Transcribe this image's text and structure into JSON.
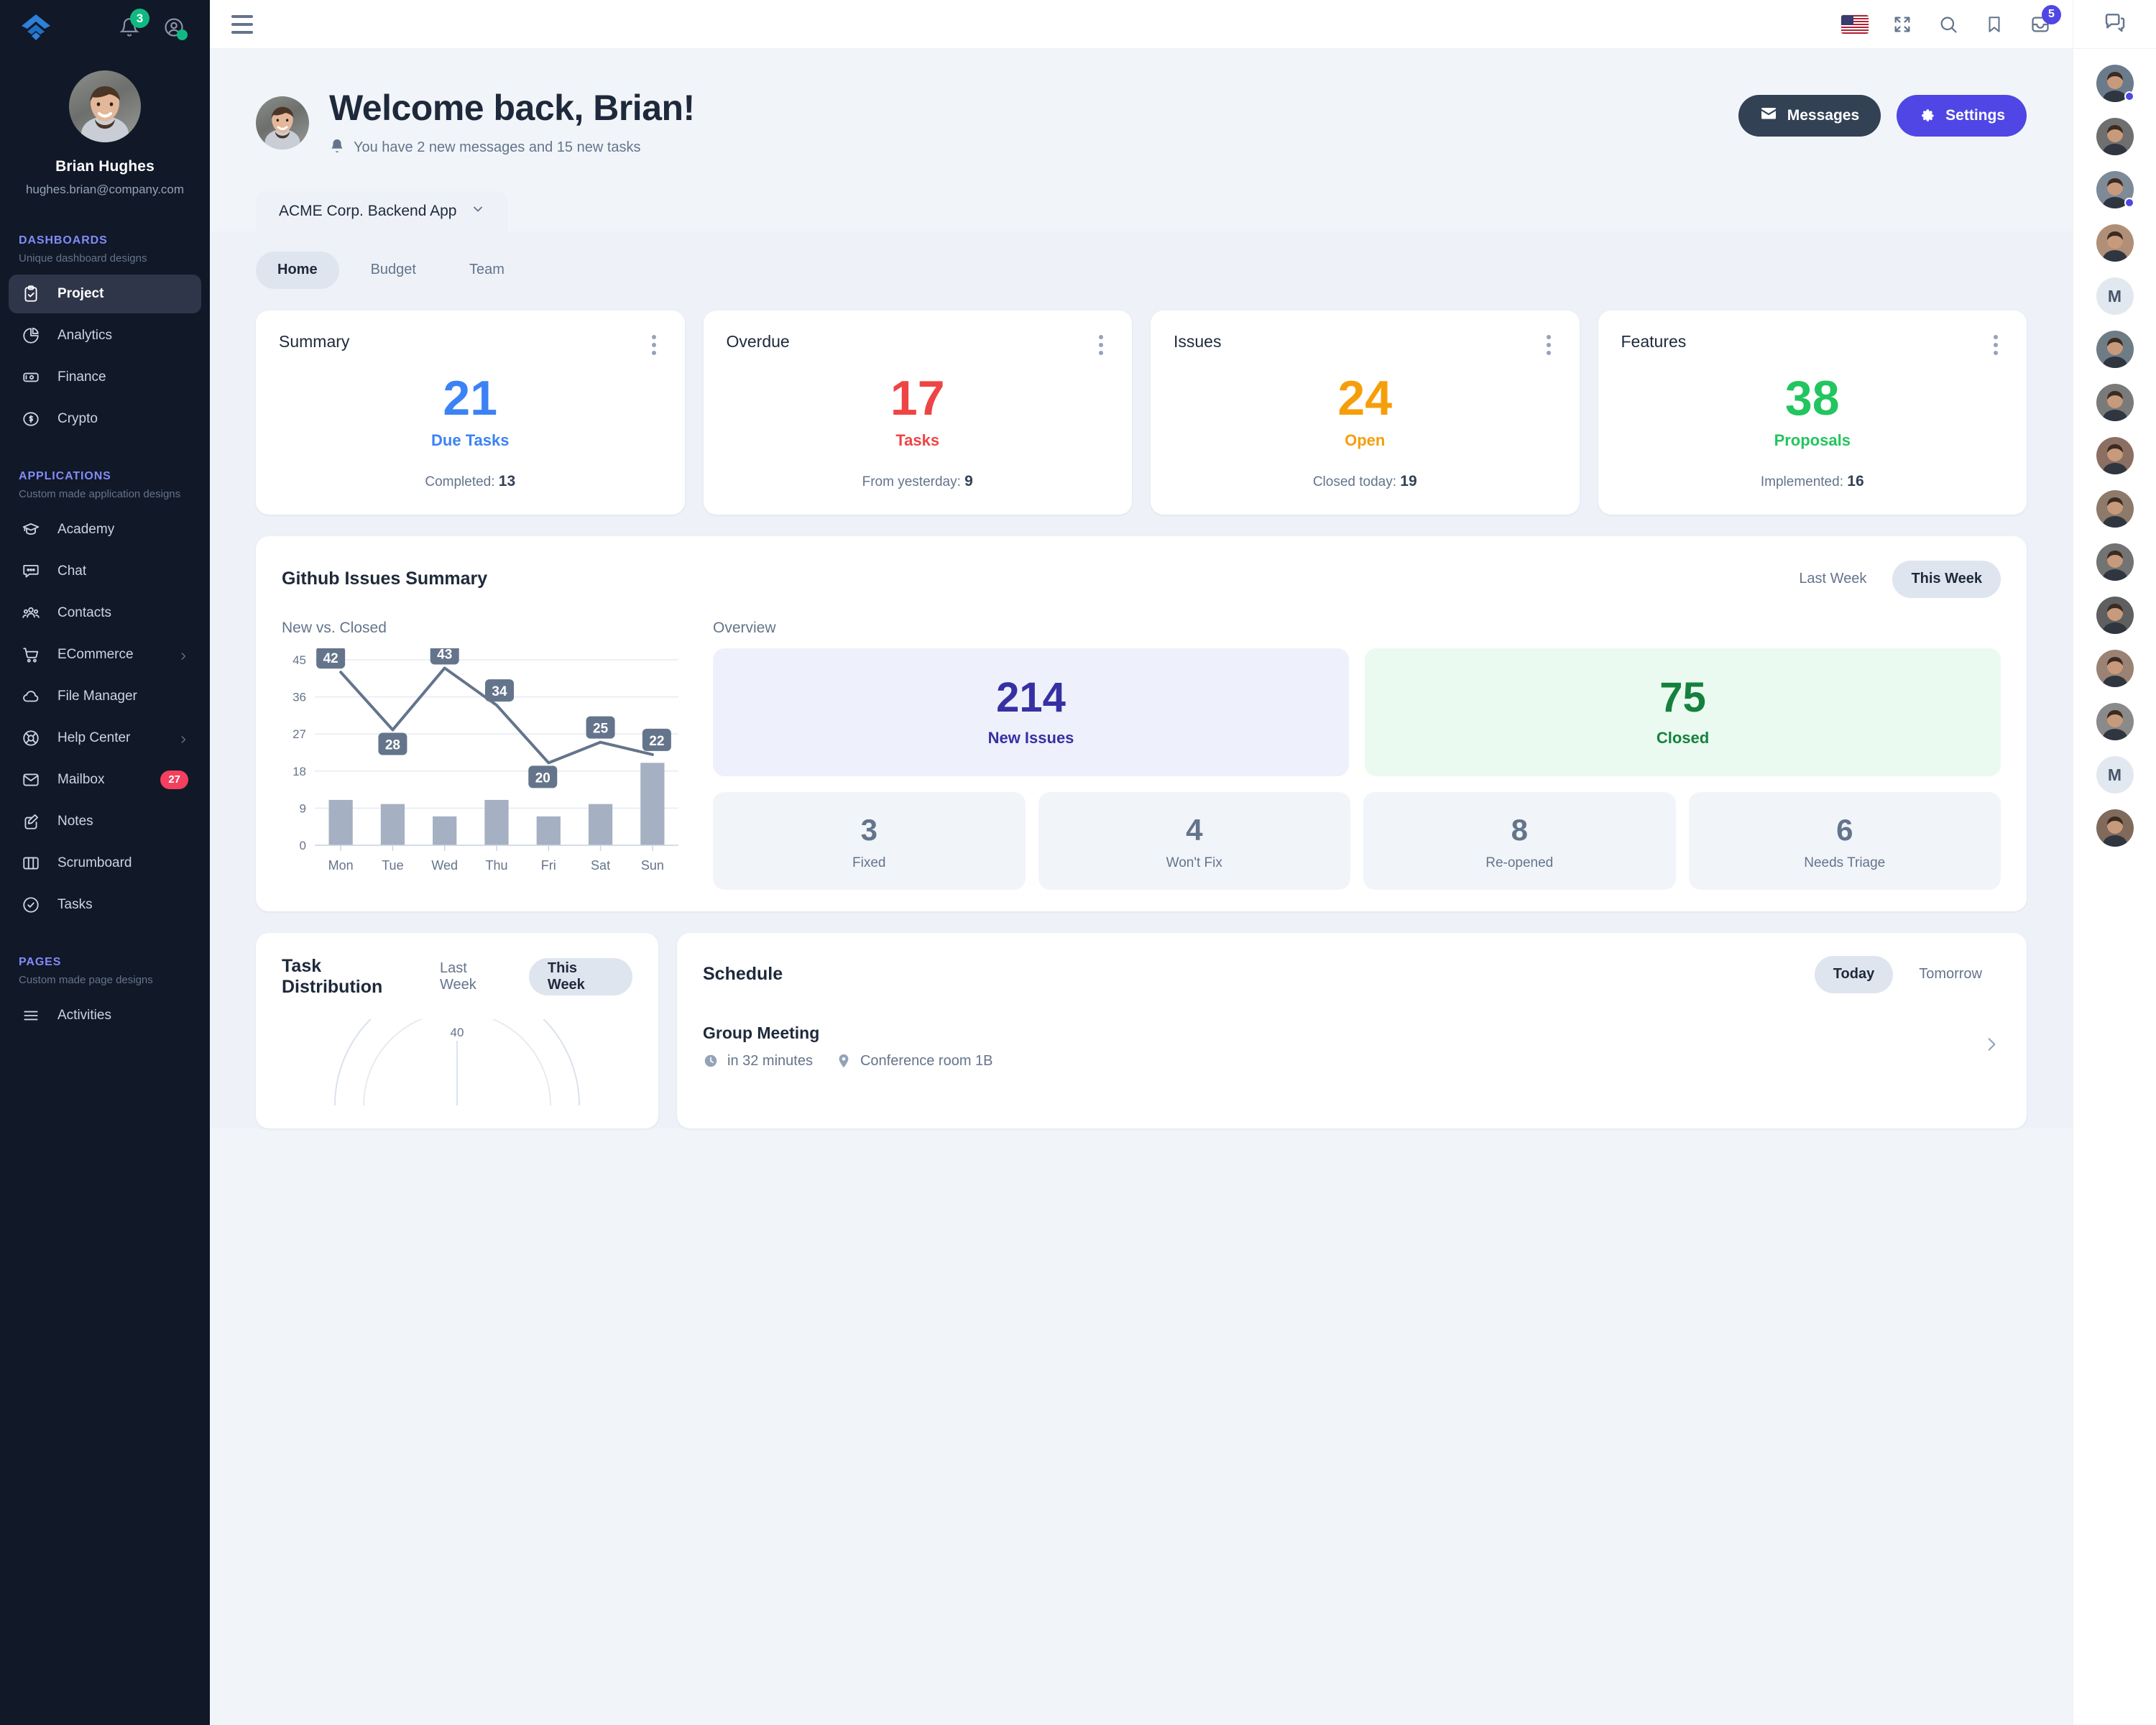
{
  "brand": {
    "accent": "#4f46e5",
    "sidebar_bg": "#111827"
  },
  "sidebar": {
    "notifications_badge": "3",
    "user": {
      "name": "Brian Hughes",
      "email": "hughes.brian@company.com"
    },
    "sections": [
      {
        "title": "DASHBOARDS",
        "subtitle": "Unique dashboard designs",
        "items": [
          {
            "label": "Project",
            "icon": "clipboard-check-icon",
            "active": true
          },
          {
            "label": "Analytics",
            "icon": "pie-chart-icon",
            "active": false
          },
          {
            "label": "Finance",
            "icon": "banknote-icon",
            "active": false
          },
          {
            "label": "Crypto",
            "icon": "dollar-circle-icon",
            "active": false
          }
        ]
      },
      {
        "title": "APPLICATIONS",
        "subtitle": "Custom made application designs",
        "items": [
          {
            "label": "Academy",
            "icon": "graduation-cap-icon",
            "active": false
          },
          {
            "label": "Chat",
            "icon": "chat-bubble-icon",
            "active": false
          },
          {
            "label": "Contacts",
            "icon": "people-icon",
            "active": false
          },
          {
            "label": "ECommerce",
            "icon": "shopping-cart-icon",
            "active": false,
            "chevron": true
          },
          {
            "label": "File Manager",
            "icon": "cloud-icon",
            "active": false
          },
          {
            "label": "Help Center",
            "icon": "lifebuoy-icon",
            "active": false,
            "chevron": true
          },
          {
            "label": "Mailbox",
            "icon": "envelope-icon",
            "active": false,
            "badge": "27"
          },
          {
            "label": "Notes",
            "icon": "pencil-square-icon",
            "active": false
          },
          {
            "label": "Scrumboard",
            "icon": "columns-icon",
            "active": false
          },
          {
            "label": "Tasks",
            "icon": "check-circle-icon",
            "active": false
          }
        ]
      },
      {
        "title": "PAGES",
        "subtitle": "Custom made page designs",
        "items": [
          {
            "label": "Activities",
            "icon": "list-icon",
            "active": false
          }
        ]
      }
    ]
  },
  "topbar": {
    "menu_icon": "hamburger-icon",
    "language_icon": "us-flag-icon",
    "fullscreen_icon": "fullscreen-icon",
    "search_icon": "search-icon",
    "bookmark_icon": "bookmark-icon",
    "inbox_icon": "inbox-icon",
    "inbox_badge": "5",
    "chat_icon": "chat-panel-icon"
  },
  "welcome": {
    "title": "Welcome back, Brian!",
    "subtitle": "You have 2 new messages and 15 new tasks",
    "bell_icon": "bell-icon",
    "messages_button": "Messages",
    "messages_icon": "envelope-icon",
    "settings_button": "Settings",
    "settings_icon": "gear-icon"
  },
  "project_tab": {
    "label": "ACME Corp. Backend App",
    "chevron_icon": "chevron-down-icon"
  },
  "subtabs": [
    {
      "label": "Home",
      "active": true
    },
    {
      "label": "Budget",
      "active": false
    },
    {
      "label": "Team",
      "active": false
    }
  ],
  "stat_cards": [
    {
      "title": "Summary",
      "value": "21",
      "value_label": "Due Tasks",
      "color": "#3b82f6",
      "foot_label": "Completed:",
      "foot_value": "13"
    },
    {
      "title": "Overdue",
      "value": "17",
      "value_label": "Tasks",
      "color": "#ef4444",
      "foot_label": "From yesterday:",
      "foot_value": "9"
    },
    {
      "title": "Issues",
      "value": "24",
      "value_label": "Open",
      "color": "#f59e0b",
      "foot_label": "Closed today:",
      "foot_value": "19"
    },
    {
      "title": "Features",
      "value": "38",
      "value_label": "Proposals",
      "color": "#22c55e",
      "foot_label": "Implemented:",
      "foot_value": "16"
    }
  ],
  "github": {
    "title": "Github Issues Summary",
    "range_toggle": [
      {
        "label": "Last Week",
        "active": false
      },
      {
        "label": "This Week",
        "active": true
      }
    ],
    "chart_label": "New vs. Closed",
    "overview_label": "Overview",
    "overview_big": [
      {
        "value": "214",
        "label": "New Issues",
        "color": "#3730a3",
        "bg": "#eef0fc"
      },
      {
        "value": "75",
        "label": "Closed",
        "color": "#15803d",
        "bg": "#eafaf0"
      }
    ],
    "overview_small": [
      {
        "value": "3",
        "label": "Fixed"
      },
      {
        "value": "4",
        "label": "Won't Fix"
      },
      {
        "value": "8",
        "label": "Re-opened"
      },
      {
        "value": "6",
        "label": "Needs Triage"
      }
    ]
  },
  "chart_data": {
    "type": "bar",
    "title": "New vs. Closed",
    "categories": [
      "Mon",
      "Tue",
      "Wed",
      "Thu",
      "Fri",
      "Sat",
      "Sun"
    ],
    "series": [
      {
        "name": "New",
        "type": "line",
        "values": [
          42,
          28,
          43,
          34,
          20,
          25,
          22
        ],
        "labels_shown": true,
        "color": "#64748b"
      },
      {
        "name": "Closed",
        "type": "bar",
        "values": [
          11,
          10,
          7,
          11,
          7,
          10,
          20
        ],
        "color": "#a5b0c2"
      }
    ],
    "xlabel": "",
    "ylabel": "",
    "yticks": [
      0,
      9,
      18,
      27,
      36,
      45
    ],
    "ylim": [
      0,
      45
    ],
    "grid": true,
    "legend": "none"
  },
  "task_distribution": {
    "title": "Task Distribution",
    "range_toggle": [
      {
        "label": "Last Week",
        "active": false
      },
      {
        "label": "This Week",
        "active": true
      }
    ],
    "radar_top_tick": "40"
  },
  "schedule": {
    "title": "Schedule",
    "range_toggle": [
      {
        "label": "Today",
        "active": true
      },
      {
        "label": "Tomorrow",
        "active": false
      }
    ],
    "items": [
      {
        "title": "Group Meeting",
        "time": "in 32 minutes",
        "location": "Conference room 1B",
        "time_icon": "clock-icon",
        "location_icon": "map-pin-icon",
        "chevron_icon": "chevron-right-icon"
      }
    ]
  },
  "right_rail": {
    "panel_icon": "chat-panel-icon",
    "contacts": [
      {
        "kind": "photo",
        "tone": "#6b7b8c",
        "status": "#4f46e5"
      },
      {
        "kind": "photo",
        "tone": "#6f6f6f",
        "status": ""
      },
      {
        "kind": "photo",
        "tone": "#7d8a98",
        "status": "#4f46e5"
      },
      {
        "kind": "photo",
        "tone": "#b08f78",
        "status": ""
      },
      {
        "kind": "initial",
        "initial": "M",
        "status": ""
      },
      {
        "kind": "photo",
        "tone": "#6e7c86",
        "status": ""
      },
      {
        "kind": "photo",
        "tone": "#7a7a7a",
        "status": ""
      },
      {
        "kind": "photo",
        "tone": "#8b6f63",
        "status": ""
      },
      {
        "kind": "photo",
        "tone": "#8d7a6b",
        "status": ""
      },
      {
        "kind": "photo",
        "tone": "#737373",
        "status": ""
      },
      {
        "kind": "photo",
        "tone": "#5f5f5f",
        "status": ""
      },
      {
        "kind": "photo",
        "tone": "#9a8374",
        "status": ""
      },
      {
        "kind": "photo",
        "tone": "#8a8a8a",
        "status": ""
      },
      {
        "kind": "initial",
        "initial": "M",
        "status": ""
      },
      {
        "kind": "photo",
        "tone": "#7f6a5c",
        "status": ""
      }
    ]
  }
}
